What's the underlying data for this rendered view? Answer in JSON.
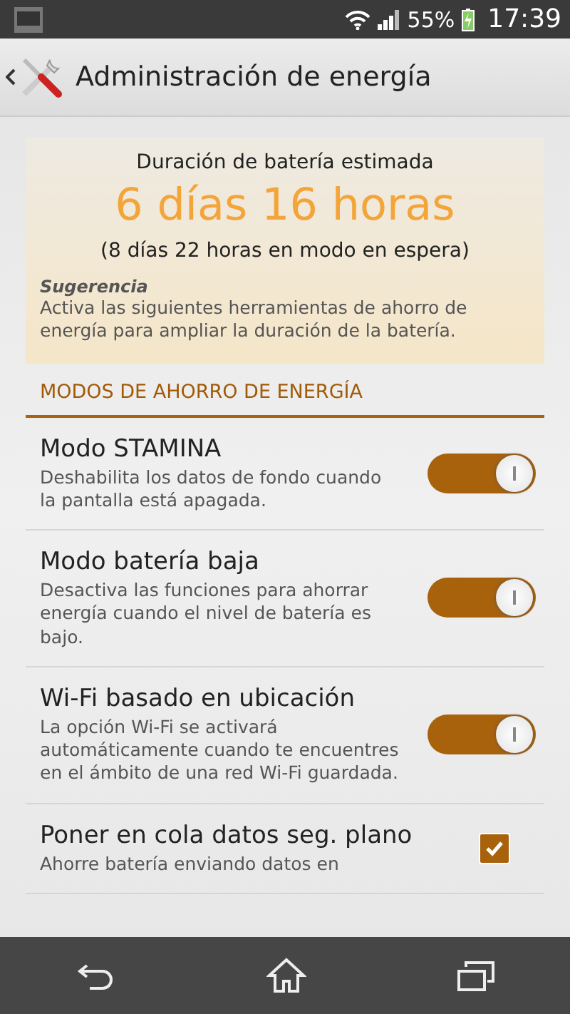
{
  "status_bar": {
    "battery": "55%",
    "time": "17:39"
  },
  "action_bar": {
    "title": "Administración de energía"
  },
  "estimate": {
    "label": "Duración de batería estimada",
    "value": "6 días 16 horas",
    "standby": "(8 días 22 horas en modo en espera)",
    "tip_title": "Sugerencia",
    "tip_text": "Activa las siguientes herramientas de ahorro de energía para ampliar la duración de la batería."
  },
  "section": {
    "title": "MODOS DE AHORRO DE ENERGÍA"
  },
  "items": [
    {
      "kind": "switch",
      "title": "Modo STAMINA",
      "description": "Deshabilita los datos de fondo cuando la pantalla está apagada.",
      "on": true
    },
    {
      "kind": "switch",
      "title": "Modo batería baja",
      "description": "Desactiva las funciones para ahorrar energía cuando el nivel de batería es bajo.",
      "on": true
    },
    {
      "kind": "switch",
      "title": "Wi-Fi basado en ubicación",
      "description": "La opción Wi-Fi se activará automáticamente cuando te encuentres en el ámbito de una red Wi-Fi guardada.",
      "on": true
    },
    {
      "kind": "checkbox",
      "title": "Poner en cola datos seg. plano",
      "description": "Ahorre batería enviando datos en",
      "on": true
    }
  ]
}
